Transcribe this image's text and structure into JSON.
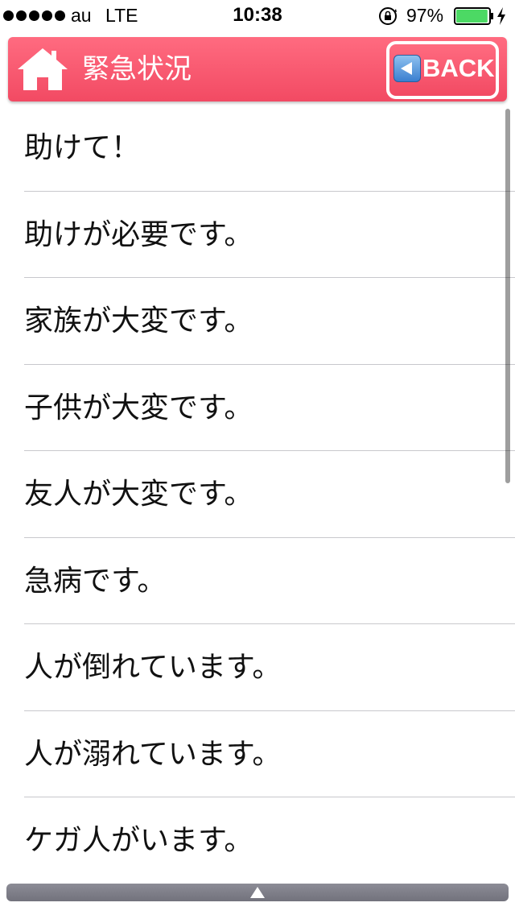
{
  "status_bar": {
    "carrier": "au",
    "network": "LTE",
    "time": "10:38",
    "battery_percent": "97%",
    "battery_level": 0.97,
    "battery_color": "#4cd964"
  },
  "header": {
    "title": "緊急状況",
    "back_label": "BACK",
    "background_color": "#f24a63",
    "home_icon": "home-icon",
    "back_icon": "left-arrow-icon"
  },
  "phrases": [
    "助けて！",
    "助けが必要です。",
    "家族が大変です。",
    "子供が大変です。",
    "友人が大変です。",
    "急病です。",
    "人が倒れています。",
    "人が溺れています。",
    "ケガ人がいます。"
  ],
  "bottom_bar": {
    "icon": "caret-up-icon"
  }
}
